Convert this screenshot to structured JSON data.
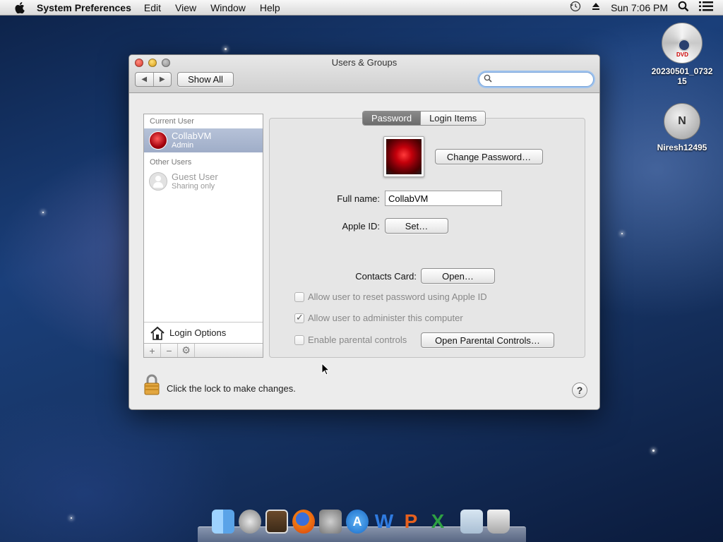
{
  "menubar": {
    "app_name": "System Preferences",
    "menus": [
      "Edit",
      "View",
      "Window",
      "Help"
    ],
    "clock": "Sun 7:06 PM",
    "icons": [
      "apple-icon",
      "time-machine-icon",
      "eject-icon",
      "spotlight-icon",
      "notification-list-icon"
    ]
  },
  "desktop": {
    "icons": [
      {
        "label": "20230501_073215",
        "icon": "dvd-disc-icon",
        "badge": "DVD"
      },
      {
        "label": "Niresh12495",
        "icon": "hard-disk-icon",
        "badge": "N"
      }
    ]
  },
  "window": {
    "title": "Users & Groups",
    "show_all": "Show All",
    "search_placeholder": ""
  },
  "sidebar": {
    "current_user_header": "Current User",
    "current_user": {
      "name": "CollabVM",
      "role": "Admin"
    },
    "other_users_header": "Other Users",
    "other_users": [
      {
        "name": "Guest User",
        "role": "Sharing only"
      }
    ],
    "login_options": "Login Options",
    "bottom_buttons": [
      "+",
      "−",
      "⚙"
    ]
  },
  "tabs": {
    "password": "Password",
    "login_items": "Login Items",
    "active": "Password"
  },
  "details": {
    "change_password": "Change Password…",
    "full_name_label": "Full name:",
    "full_name_value": "CollabVM",
    "apple_id_label": "Apple ID:",
    "set_button": "Set…",
    "contacts_label": "Contacts Card:",
    "open_button": "Open…",
    "checkbox_reset": "Allow user to reset password using Apple ID",
    "checkbox_admin": "Allow user to administer this computer",
    "checkbox_parental": "Enable parental controls",
    "open_parental": "Open Parental Controls…",
    "checkbox_states": {
      "reset": false,
      "admin": true,
      "parental": false
    }
  },
  "footer": {
    "lock_text": "Click the lock to make changes.",
    "help": "?"
  },
  "dock": {
    "items": [
      "finder-icon",
      "launchpad-icon",
      "preview-icon",
      "firefox-icon",
      "system-preferences-icon",
      "app-store-icon",
      "word-icon",
      "powerpoint-icon",
      "excel-icon",
      "documents-folder-icon",
      "trash-icon"
    ],
    "letters": {
      "word": "W",
      "powerpoint": "P",
      "excel": "X"
    }
  },
  "colors": {
    "selection": "#9fadc8",
    "accent_blue": "#7aa4d8",
    "close": "#d9372b",
    "minimize": "#d79b14"
  }
}
